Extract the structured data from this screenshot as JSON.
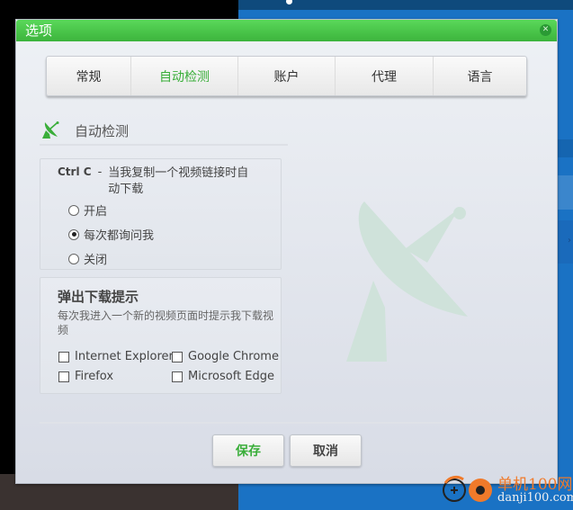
{
  "dialog": {
    "title": "选项",
    "close_icon": "close-icon"
  },
  "tabs": [
    {
      "label": "常规",
      "active": false
    },
    {
      "label": "自动检测",
      "active": true
    },
    {
      "label": "账户",
      "active": false
    },
    {
      "label": "代理",
      "active": false
    },
    {
      "label": "语言",
      "active": false
    }
  ],
  "section": {
    "icon": "satellite-dish-icon",
    "title": "自动检测"
  },
  "ctrl_c": {
    "key": "Ctrl C",
    "separator": "-",
    "description": "当我复制一个视频链接时自动下载",
    "options": [
      {
        "label": "开启",
        "checked": false
      },
      {
        "label": "每次都询问我",
        "checked": true
      },
      {
        "label": "关闭",
        "checked": false
      }
    ]
  },
  "popup": {
    "title": "弹出下载提示",
    "description": "每次我进入一个新的视频页面时提示我下载视频",
    "browsers": [
      {
        "label": "Internet Explorer",
        "checked": false
      },
      {
        "label": "Google Chrome",
        "checked": false
      },
      {
        "label": "Firefox",
        "checked": false
      },
      {
        "label": "Microsoft Edge",
        "checked": false
      }
    ]
  },
  "buttons": {
    "save": "保存",
    "cancel": "取消"
  },
  "watermark": {
    "site_name": "单机100网",
    "site_url": "danji100.com"
  },
  "colors": {
    "accent_green": "#3aae3a",
    "titlebar_green": "#4ccc4c",
    "watermark_orange": "#f07a2a"
  }
}
